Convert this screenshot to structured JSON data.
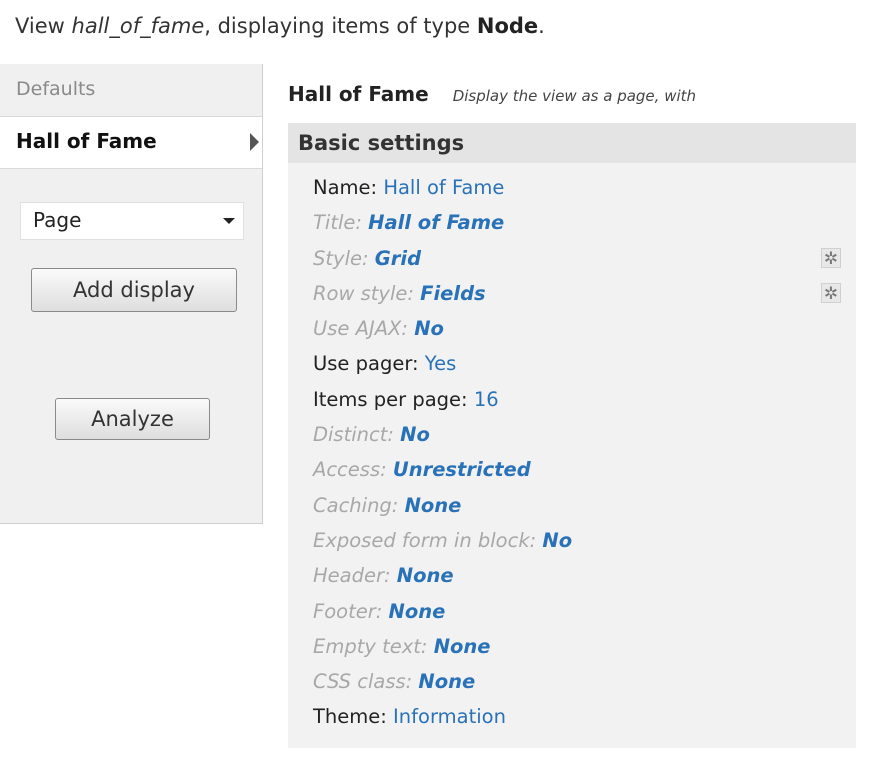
{
  "header": {
    "prefix": "View ",
    "view_name": "hall_of_fame",
    "middle": ", displaying items of type ",
    "type": "Node",
    "suffix": "."
  },
  "sidebar": {
    "tabs": [
      {
        "label": "Defaults",
        "active": false
      },
      {
        "label": "Hall of Fame",
        "active": true
      }
    ],
    "display_select": {
      "value": "Page"
    },
    "add_display_label": "Add display",
    "analyze_label": "Analyze"
  },
  "main": {
    "display_name": "Hall of Fame",
    "display_description": "Display the view as a page, with",
    "panel_title": "Basic settings",
    "settings": [
      {
        "label": "Name:",
        "value": "Hall of Fame",
        "overridden": true
      },
      {
        "label": "Title:",
        "value": "Hall of Fame",
        "overridden": false
      },
      {
        "label": "Style:",
        "value": "Grid",
        "overridden": false,
        "gear": true
      },
      {
        "label": "Row style:",
        "value": "Fields",
        "overridden": false,
        "gear": true
      },
      {
        "label": "Use AJAX:",
        "value": "No",
        "overridden": false
      },
      {
        "label": "Use pager:",
        "value": "Yes",
        "overridden": true
      },
      {
        "label": "Items per page:",
        "value": "16",
        "overridden": true
      },
      {
        "label": "Distinct:",
        "value": "No",
        "overridden": false
      },
      {
        "label": "Access:",
        "value": "Unrestricted",
        "overridden": false
      },
      {
        "label": "Caching:",
        "value": "None",
        "overridden": false
      },
      {
        "label": "Exposed form in block:",
        "value": "No",
        "overridden": false
      },
      {
        "label": "Header:",
        "value": "None",
        "overridden": false
      },
      {
        "label": "Footer:",
        "value": "None",
        "overridden": false
      },
      {
        "label": "Empty text:",
        "value": "None",
        "overridden": false
      },
      {
        "label": "CSS class:",
        "value": "None",
        "overridden": false
      },
      {
        "label": "Theme:",
        "value": "Information",
        "overridden": true
      }
    ]
  },
  "icons": {
    "gear": "gear-icon",
    "arrow": "triangle-right-icon",
    "caret": "chevron-down-icon"
  },
  "colors": {
    "link": "#2a72b8",
    "dim_label": "#a8a8a8",
    "panel_bg": "#f2f2f2"
  }
}
